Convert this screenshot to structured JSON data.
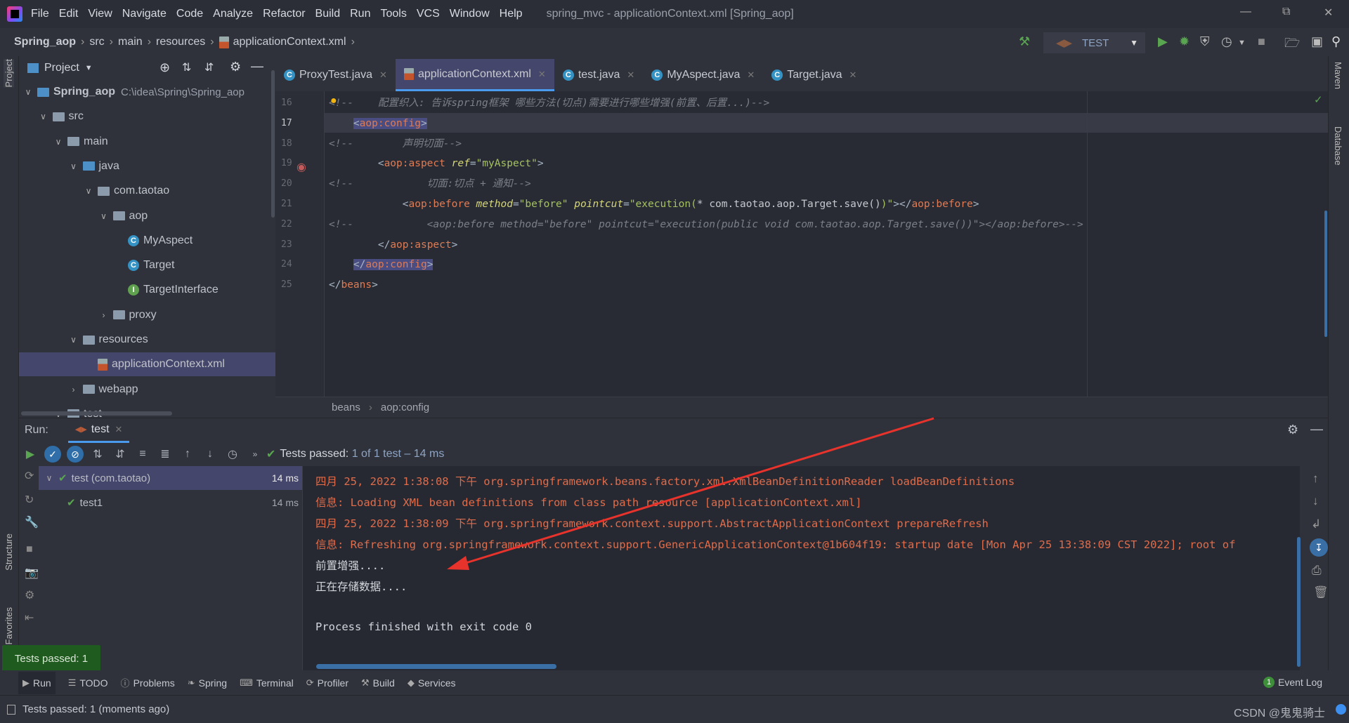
{
  "menubar": {
    "items": [
      "File",
      "Edit",
      "View",
      "Navigate",
      "Code",
      "Analyze",
      "Refactor",
      "Build",
      "Run",
      "Tools",
      "VCS",
      "Window",
      "Help"
    ],
    "title": "spring_mvc - applicationContext.xml [Spring_aop]"
  },
  "navbar": {
    "crumbs": [
      "Spring_aop",
      "src",
      "main",
      "resources",
      "applicationContext.xml"
    ],
    "run_config": "TEST"
  },
  "left_stripe": {
    "project": "Project",
    "structure": "Structure",
    "favorites": "Favorites"
  },
  "right_stripe": {
    "maven": "Maven",
    "database": "Database"
  },
  "project": {
    "title": "Project",
    "items": [
      {
        "label": "Spring_aop",
        "path": "C:\\idea\\Spring\\Spring_aop",
        "type": "module",
        "depth": 0,
        "chevron": "down"
      },
      {
        "label": "src",
        "type": "folder",
        "depth": 1,
        "chevron": "down"
      },
      {
        "label": "main",
        "type": "folder",
        "depth": 2,
        "chevron": "down"
      },
      {
        "label": "java",
        "type": "source-folder",
        "depth": 3,
        "chevron": "down"
      },
      {
        "label": "com.taotao",
        "type": "package",
        "depth": 4,
        "chevron": "down"
      },
      {
        "label": "aop",
        "type": "package",
        "depth": 5,
        "chevron": "down"
      },
      {
        "label": "MyAspect",
        "type": "class",
        "depth": 6
      },
      {
        "label": "Target",
        "type": "class",
        "depth": 6
      },
      {
        "label": "TargetInterface",
        "type": "interface",
        "depth": 6
      },
      {
        "label": "proxy",
        "type": "package",
        "depth": 5,
        "chevron": "right"
      },
      {
        "label": "resources",
        "type": "folder",
        "depth": 3,
        "chevron": "down"
      },
      {
        "label": "applicationContext.xml",
        "type": "xml",
        "depth": 4,
        "selected": true
      },
      {
        "label": "webapp",
        "type": "folder",
        "depth": 3,
        "chevron": "right"
      },
      {
        "label": "test",
        "type": "folder",
        "depth": 2,
        "chevron": "down"
      }
    ]
  },
  "tabs": [
    {
      "label": "ProxyTest.java",
      "icon": "class"
    },
    {
      "label": "applicationContext.xml",
      "icon": "xml",
      "active": true
    },
    {
      "label": "test.java",
      "icon": "class"
    },
    {
      "label": "MyAspect.java",
      "icon": "class"
    },
    {
      "label": "Target.java",
      "icon": "class"
    }
  ],
  "editor": {
    "lines": [
      {
        "n": "16",
        "indent": "",
        "tokens": [
          [
            "<!--",
            "t-cmt"
          ],
          [
            "    配置织入: 告诉spring框架 哪些方法(切点)需要进行哪些增强(前置、后置...)-->",
            "t-cmt"
          ]
        ]
      },
      {
        "n": "17",
        "indent": "    ",
        "current": true,
        "tokens": [
          [
            "<",
            "t-br t-hl"
          ],
          [
            "aop:config",
            "t-tag t-hl"
          ],
          [
            ">",
            "t-br t-hl"
          ]
        ]
      },
      {
        "n": "18",
        "indent": "",
        "tokens": [
          [
            "<!--",
            "t-cmt"
          ],
          [
            "        声明切面-->",
            "t-cmt"
          ]
        ]
      },
      {
        "n": "19",
        "indent": "        ",
        "tokens": [
          [
            "<",
            "t-br"
          ],
          [
            "aop:aspect",
            "t-tag"
          ],
          [
            " ",
            "t-txt"
          ],
          [
            "ref",
            "t-attr"
          ],
          [
            "=",
            "t-eq"
          ],
          [
            "\"myAspect\"",
            "t-val"
          ],
          [
            ">",
            "t-br"
          ]
        ]
      },
      {
        "n": "20",
        "indent": "",
        "tokens": [
          [
            "<!--",
            "t-cmt"
          ],
          [
            "            切面:切点 + 通知-->",
            "t-cmt"
          ]
        ]
      },
      {
        "n": "21",
        "indent": "            ",
        "tokens": [
          [
            "<",
            "t-br"
          ],
          [
            "aop:before",
            "t-tag"
          ],
          [
            " ",
            "t-txt"
          ],
          [
            "method",
            "t-attr"
          ],
          [
            "=",
            "t-eq"
          ],
          [
            "\"before\"",
            "t-val"
          ],
          [
            " ",
            "t-txt"
          ],
          [
            "pointcut",
            "t-attr"
          ],
          [
            "=",
            "t-eq"
          ],
          [
            "\"execution(",
            "t-val"
          ],
          [
            "* com.taotao.aop.Target.save()",
            "t-txt"
          ],
          [
            ")\"",
            "t-val"
          ],
          [
            "></",
            "t-br"
          ],
          [
            "aop:before",
            "t-tag"
          ],
          [
            ">",
            "t-br"
          ]
        ]
      },
      {
        "n": "22",
        "indent": "",
        "tokens": [
          [
            "<!--",
            "t-cmt"
          ],
          [
            "            <aop:before method=\"before\" pointcut=\"execution(public void com.taotao.aop.Target.save())\"></aop:before>-->",
            "t-cmt"
          ]
        ]
      },
      {
        "n": "23",
        "indent": "        ",
        "tokens": [
          [
            "</",
            "t-br"
          ],
          [
            "aop:aspect",
            "t-tag"
          ],
          [
            ">",
            "t-br"
          ]
        ]
      },
      {
        "n": "24",
        "indent": "    ",
        "tokens": [
          [
            "</",
            "t-br t-hl"
          ],
          [
            "aop:config",
            "t-tag t-hl"
          ],
          [
            ">",
            "t-br t-hl"
          ]
        ]
      },
      {
        "n": "25",
        "indent": "",
        "tokens": [
          [
            "</",
            "t-br"
          ],
          [
            "beans",
            "t-tag"
          ],
          [
            ">",
            "t-br"
          ]
        ]
      }
    ],
    "breadcrumb": [
      "beans",
      "aop:config"
    ]
  },
  "run": {
    "label": "Run:",
    "tab": "test",
    "status_prefix": "Tests passed:",
    "status_count": "1",
    "status_rest": "of 1 test – 14 ms",
    "tree": [
      {
        "label": "test (com.taotao)",
        "time": "14 ms",
        "selected": true
      },
      {
        "label": "test1",
        "time": "14 ms"
      }
    ],
    "console": [
      {
        "text": "四月 25, 2022 1:38:08 下午 org.springframework.beans.factory.xml.XmlBeanDefinitionReader loadBeanDefinitions",
        "kind": "c-red"
      },
      {
        "text": "信息: Loading XML bean definitions from class path resource [applicationContext.xml]",
        "kind": "c-red"
      },
      {
        "text": "四月 25, 2022 1:38:09 下午 org.springframework.context.support.AbstractApplicationContext prepareRefresh",
        "kind": "c-red"
      },
      {
        "text": "信息: Refreshing org.springframework.context.support.GenericApplicationContext@1b604f19: startup date [Mon Apr 25 13:38:09 CST 2022]; root of",
        "kind": "c-red"
      },
      {
        "text": "前置增强....",
        "kind": "c-plain"
      },
      {
        "text": "正在存储数据....",
        "kind": "c-plain"
      },
      {
        "text": "",
        "kind": "c-plain"
      },
      {
        "text": "Process finished with exit code 0",
        "kind": "c-plain"
      }
    ]
  },
  "toast": "Tests passed: 1",
  "bottombar": {
    "items": [
      "Run",
      "TODO",
      "Problems",
      "Spring",
      "Terminal",
      "Profiler",
      "Build",
      "Services"
    ],
    "event_log": "Event Log",
    "event_count": "1"
  },
  "status": {
    "text": "Tests passed: 1 (moments ago)",
    "watermark": "CSDN @鬼鬼骑士"
  },
  "colors": {
    "accent": "#4a9bee",
    "selection": "#45466b",
    "pass_green": "#5aa650",
    "log_red": "#e06c4b",
    "annotation_arrow": "#e8322c"
  }
}
